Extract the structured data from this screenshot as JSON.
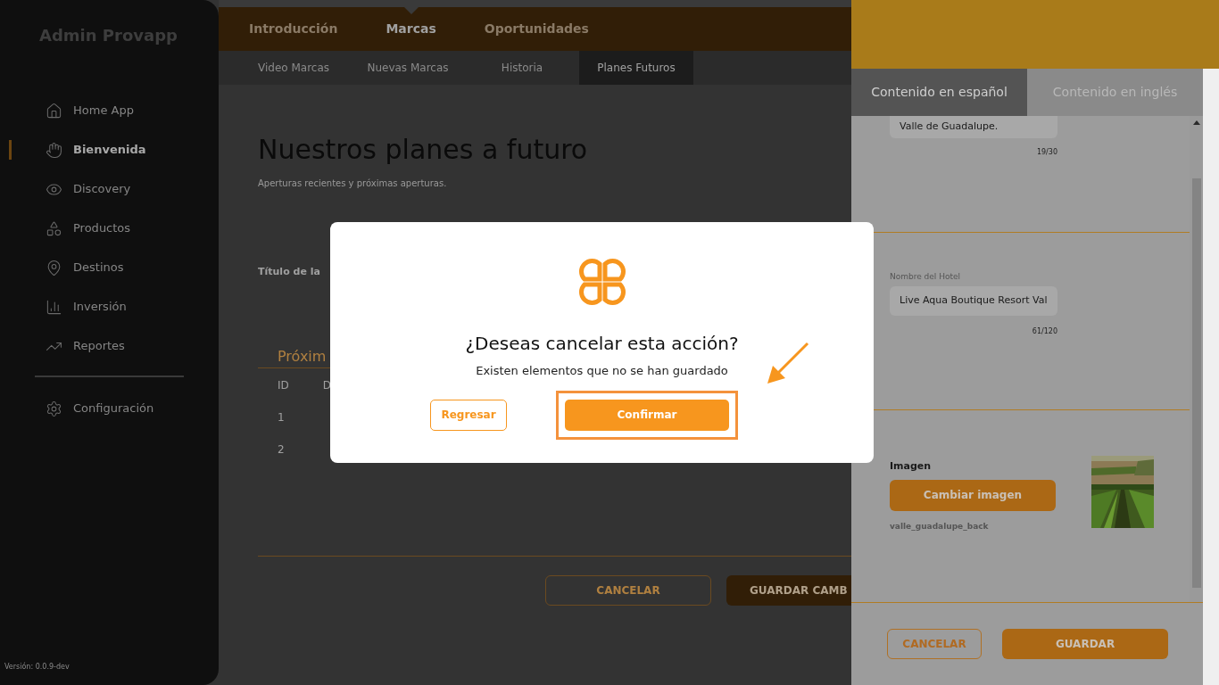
{
  "sidebar": {
    "title": "Admin Provapp",
    "items": [
      {
        "label": "Home App",
        "selected": false
      },
      {
        "label": "Bienvenida",
        "selected": true
      },
      {
        "label": "Discovery",
        "selected": false
      },
      {
        "label": "Productos",
        "selected": false
      },
      {
        "label": "Destinos",
        "selected": false
      },
      {
        "label": "Inversión",
        "selected": false
      },
      {
        "label": "Reportes",
        "selected": false
      }
    ],
    "settings": {
      "label": "Configuración",
      "selected": false
    },
    "version": "Versión: 0.0.9-dev"
  },
  "main_tabs": [
    {
      "label": "Introducción",
      "selected": false
    },
    {
      "label": "Marcas",
      "selected": true
    },
    {
      "label": "Oportunidades",
      "selected": false
    }
  ],
  "sub_tabs": [
    {
      "label": "Video Marcas",
      "selected": false
    },
    {
      "label": "Nuevas Marcas",
      "selected": false
    },
    {
      "label": "Historia",
      "selected": false
    },
    {
      "label": "Planes Futuros",
      "selected": true
    }
  ],
  "page": {
    "title": "Nuestros planes a futuro",
    "subtitle": "Aperturas recientes y próximas aperturas.",
    "field_label": "Título de la",
    "section": "Próxim",
    "table": {
      "columns": [
        "ID",
        "D"
      ],
      "rows": [
        [
          "1"
        ],
        [
          "2"
        ]
      ]
    },
    "buttons": {
      "cancel": "CANCELAR",
      "save": "GUARDAR CAMB"
    }
  },
  "panel": {
    "tabs": [
      {
        "label": "Contenido en español",
        "selected": true
      },
      {
        "label": "Contenido en inglés",
        "selected": false
      }
    ],
    "fields": [
      {
        "value": "Valle de Guadalupe.",
        "counter": "19/30"
      },
      {
        "label": "Nombre del Hotel",
        "value": "Live Aqua Boutique Resort Val",
        "counter": "61/120"
      }
    ],
    "image": {
      "label": "Imagen",
      "button": "Cambiar imagen",
      "filename": "valle_guadalupe_back"
    },
    "buttons": {
      "cancel": "CANCELAR",
      "save": "GUARDAR"
    }
  },
  "dialog": {
    "title": "¿Deseas cancelar esta acción?",
    "message": "Existen elementos que no se han guardado",
    "back": "Regresar",
    "confirm": "Confirmar",
    "highlight": true
  }
}
